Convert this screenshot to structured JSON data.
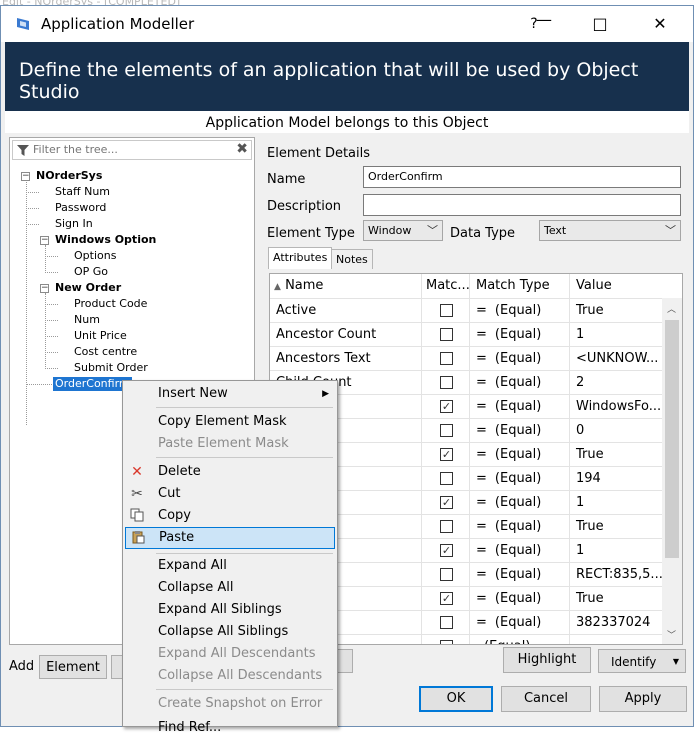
{
  "background_title": "Edit - NOrderSys - [COMPLETED]",
  "window": {
    "title": "Application Modeller",
    "help_label": "?",
    "minimize_label": "—",
    "maximize_label": "□",
    "close_label": "✕",
    "banner": "Define the elements of an application that will be used by Object Studio",
    "subheading": "Application Model belongs to this Object"
  },
  "tree": {
    "filter_placeholder": "Filter the tree...",
    "clear_label": "✖",
    "root": "NOrderSys",
    "items": [
      "Staff Num",
      "Password",
      "Sign In"
    ],
    "group1": {
      "label": "Windows Option",
      "children": [
        "Options",
        "OP Go"
      ]
    },
    "group2": {
      "label": "New Order",
      "children": [
        "Product Code",
        "Num",
        "Unit Price",
        "Cost centre",
        "Submit Order"
      ]
    },
    "selected": "OrderConfirm"
  },
  "details": {
    "heading": "Element Details",
    "name_label": "Name",
    "name_value": "OrderConfirm",
    "description_label": "Description",
    "description_value": "",
    "element_type_label": "Element Type",
    "element_type_value": "Window",
    "data_type_label": "Data Type",
    "data_type_value": "Text",
    "tabs": [
      "Attributes",
      "Notes"
    ]
  },
  "grid": {
    "headers": [
      "Name",
      "Matc...",
      "Match Type",
      "Value"
    ],
    "rows": [
      {
        "name": "Active",
        "checked": false,
        "eq": "=",
        "type": "(Equal)",
        "value": "True"
      },
      {
        "name": "Ancestor Count",
        "checked": false,
        "eq": "=",
        "type": "(Equal)",
        "value": "1"
      },
      {
        "name": "Ancestors Text",
        "checked": false,
        "eq": "=",
        "type": "(Equal)",
        "value": "<UNKNOW..."
      },
      {
        "name": "Child Count",
        "checked": false,
        "eq": "=",
        "type": "(Equal)",
        "value": "2"
      },
      {
        "name": "e",
        "checked": true,
        "eq": "=",
        "type": "(Equal)",
        "value": "WindowsFo..."
      },
      {
        "name": "",
        "checked": false,
        "eq": "=",
        "type": "(Equal)",
        "value": "0"
      },
      {
        "name": "",
        "checked": true,
        "eq": "=",
        "type": "(Equal)",
        "value": "True"
      },
      {
        "name": "",
        "checked": false,
        "eq": "=",
        "type": "(Equal)",
        "value": "194"
      },
      {
        "name": "ex",
        "checked": true,
        "eq": "=",
        "type": "(Equal)",
        "value": "1"
      },
      {
        "name": "verse",
        "checked": false,
        "eq": "=",
        "type": "(Equal)",
        "value": "True"
      },
      {
        "name": "",
        "checked": true,
        "eq": "=",
        "type": "(Equal)",
        "value": "1"
      },
      {
        "name": "unds",
        "checked": false,
        "eq": "=",
        "type": "(Equal)",
        "value": "RECT:835,5..."
      },
      {
        "name": "ible",
        "checked": true,
        "eq": "=",
        "type": "(Equal)",
        "value": "True"
      },
      {
        "name": "",
        "checked": false,
        "eq": "=",
        "type": "(Equal)",
        "value": "382337024"
      },
      {
        "name": "",
        "checked": false,
        "eq": "",
        "type": "(Equal)",
        "value": ""
      }
    ]
  },
  "bottom": {
    "add_label": "Add",
    "element_button": "Element",
    "highlight_button": "Highlight",
    "identify_button": "Identify",
    "ok_button": "OK",
    "cancel_button": "Cancel",
    "apply_button": "Apply"
  },
  "context_menu": {
    "insert_new": "Insert New",
    "copy_mask": "Copy Element Mask",
    "paste_mask": "Paste Element Mask",
    "delete": "Delete",
    "cut": "Cut",
    "copy": "Copy",
    "paste": "Paste",
    "expand_all": "Expand All",
    "collapse_all": "Collapse All",
    "expand_siblings": "Expand All Siblings",
    "collapse_siblings": "Collapse All Siblings",
    "expand_desc": "Expand All Descendants",
    "collapse_desc": "Collapse All Descendants",
    "snapshot": "Create Snapshot on Error",
    "find_ref": "Find Ref..."
  }
}
